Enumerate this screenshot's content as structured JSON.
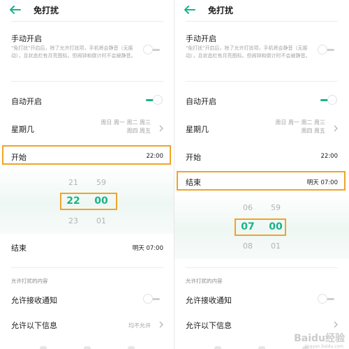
{
  "accent_color": "#1ab38a",
  "highlight_color": "#f0a428",
  "left": {
    "title": "免打扰",
    "manual": {
      "label": "手动开启",
      "desc": "\"免打扰\"开启后，除了允许打扰项，手机将会静音（无振动），且状态栏有月亮图标。但闹钟和倒计时不会被静音。",
      "toggle": "off"
    },
    "auto": {
      "label": "自动开启",
      "toggle": "on"
    },
    "weekday": {
      "label": "星期几",
      "line1": "周日 周一 周二 周三",
      "line2": "周四 周五"
    },
    "start": {
      "label": "开始",
      "value": "22:00"
    },
    "wheel": {
      "hour_prev": "21",
      "hour_sel": "22",
      "hour_next": "23",
      "min_prev": "59",
      "min_sel": "00",
      "min_next": "01"
    },
    "end": {
      "label": "结束",
      "value": "明天 07:00"
    },
    "allowed_section": "允许打扰的内容",
    "notify": {
      "label": "允许接收通知",
      "toggle": "off"
    },
    "messages": {
      "label": "允许以下信息",
      "value": "均不允许"
    }
  },
  "right": {
    "title": "免打扰",
    "manual": {
      "label": "手动开启",
      "desc": "\"免打扰\"开启后，除了允许打扰项，手机将会静音（无振动），且状态栏有月亮图标。但闹钟和倒计时不会被静音。",
      "toggle": "off"
    },
    "auto": {
      "label": "自动开启",
      "toggle": "on"
    },
    "weekday": {
      "label": "星期几",
      "line1": "周日 周一 周二 周三",
      "line2": "周四 周五"
    },
    "start": {
      "label": "开始",
      "value": "22:00"
    },
    "end": {
      "label": "结束",
      "value": "明天 07:00"
    },
    "wheel": {
      "hour_prev": "06",
      "hour_sel": "07",
      "hour_next": "08",
      "min_prev": "59",
      "min_sel": "00",
      "min_next": "01"
    },
    "allowed_section": "允许打扰的内容",
    "notify": {
      "label": "允许接收通知",
      "toggle": "off"
    },
    "messages": {
      "label": "允许以下信息"
    }
  },
  "watermark": {
    "text": "Baidu经验",
    "sub": "jingyan.baidu.com"
  }
}
